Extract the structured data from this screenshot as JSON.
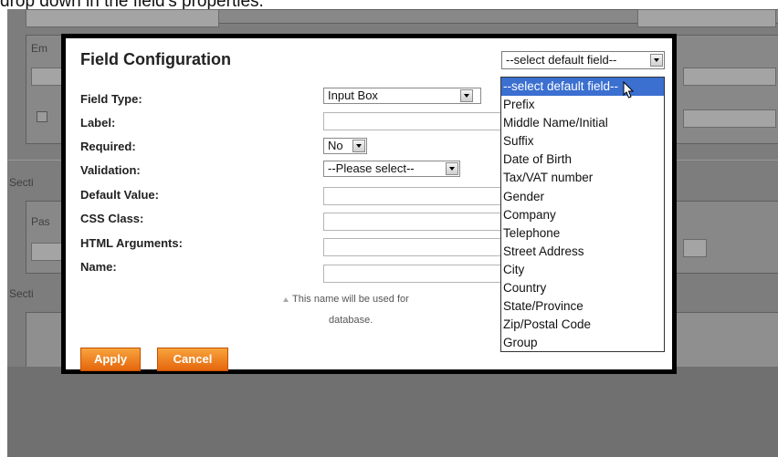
{
  "caption": "drop down in the field's properties.",
  "background": {
    "labels": [
      "Em",
      "Secti",
      "Pas",
      "Secti"
    ]
  },
  "modal": {
    "title": "Field Configuration",
    "default_field_select": {
      "value": "--select default field--",
      "options": [
        "--select default field--",
        "Prefix",
        "Middle Name/Initial",
        "Suffix",
        "Date of Birth",
        "Tax/VAT number",
        "Gender",
        "Company",
        "Telephone",
        "Street Address",
        "City",
        "Country",
        "State/Province",
        "Zip/Postal Code",
        "Group"
      ],
      "highlighted_index": 0
    },
    "form": {
      "field_type_label": "Field Type:",
      "field_type_value": "Input Box",
      "label_label": "Label:",
      "label_value": "",
      "required_label": "Required:",
      "required_value": "No",
      "validation_label": "Validation:",
      "validation_value": "--Please select--",
      "default_value_label": "Default Value:",
      "default_value_value": "",
      "css_class_label": "CSS Class:",
      "css_class_value": "",
      "html_arguments_label": "HTML Arguments:",
      "html_arguments_value": "",
      "name_label": "Name:",
      "name_value": "",
      "name_note_line1": "This name will be used for",
      "name_note_line2": "database."
    },
    "buttons": {
      "apply": "Apply",
      "cancel": "Cancel"
    },
    "colors": {
      "button_orange": "#f08020",
      "highlight_blue": "#3b6fd0"
    }
  }
}
